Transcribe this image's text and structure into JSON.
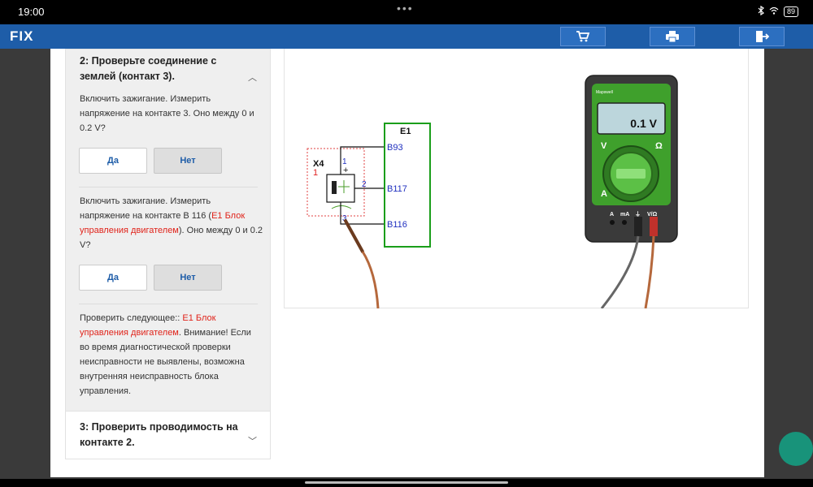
{
  "status": {
    "time": "19:00",
    "dots": "•••",
    "battery": "89"
  },
  "appbar": {
    "logo": "FIX",
    "buttons": [
      {
        "icon": "cart-icon"
      },
      {
        "icon": "printer-icon"
      },
      {
        "icon": "exit-icon"
      }
    ]
  },
  "step2": {
    "title": "2: Проверьте соединение с землей (контакт 3).",
    "q1": "Включить зажигание. Измерить напряжение на контакте 3. Оно между 0 и 0.2 V?",
    "q2_before": "Включить зажигание. Измерить напряжение на контакте В 116 (",
    "q2_link": "E1 Блок управления двигателем",
    "q2_after": "). Оно между 0 и 0.2 V?",
    "check_before": "Проверить следующее:: ",
    "check_link": "E1 Блок управления двигателем",
    "check_after": ". Внимание! Если во время диагностической проверки неисправности не выявлены, возможна внутренняя неисправность блока управления.",
    "yes_label": "Да",
    "no_label": "Нет"
  },
  "step3": {
    "title": "3: Проверить проводимость на контакте 2."
  },
  "diagram": {
    "ecu_label": "E1",
    "pins": [
      "B93",
      "B117",
      "B116"
    ],
    "connector_label": "X4",
    "connector_num": "1",
    "sensor_pins": [
      "1",
      "2",
      "3"
    ],
    "meter": {
      "brand": "Mapswell",
      "reading": "0.1 V",
      "label_v": "V",
      "label_ohm": "Ω",
      "label_a": "A",
      "jack_labels": [
        "A",
        "mA",
        "⏚",
        "V/Ω"
      ]
    }
  },
  "colors": {
    "appbar": "#1e5da8",
    "ecu_border": "#1a9e1a",
    "pin_text": "#1f2fbf",
    "link_red": "#e0231a",
    "meter_green": "#3fa02c",
    "fab": "#18937a"
  }
}
